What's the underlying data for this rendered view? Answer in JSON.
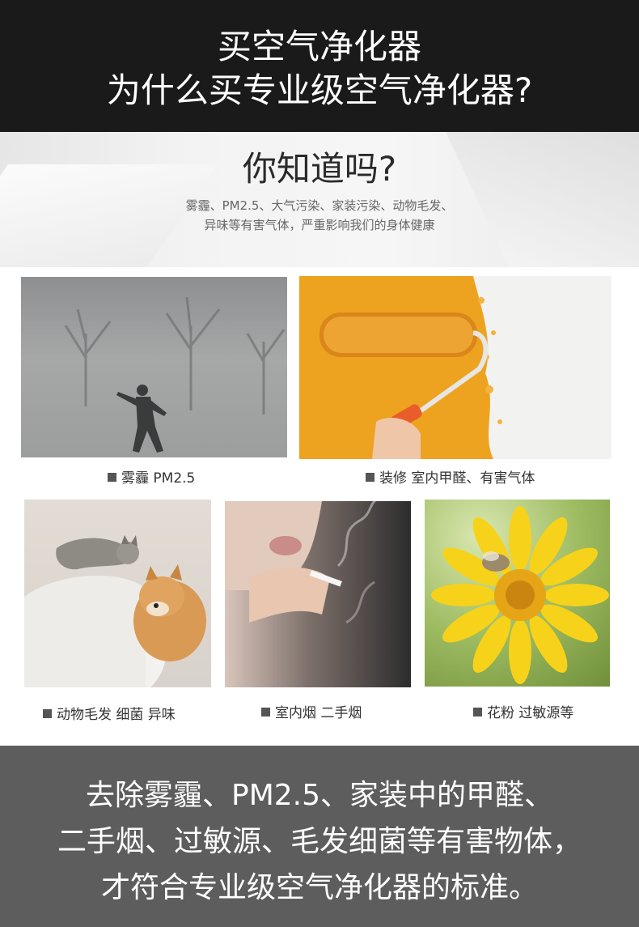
{
  "header": {
    "line1": "买空气净化器",
    "line2": "为什么买专业级空气净化器?"
  },
  "intro": {
    "question": "你知道吗?",
    "desc_line1": "雾霾、PM2.5、大气污染、家装污染、动物毛发、",
    "desc_line2": "异味等有害气体，严重影响我们的身体健康"
  },
  "cards": [
    {
      "caption": "雾霾 PM2.5",
      "image": "smog-photo"
    },
    {
      "caption": "装修  室内甲醛、有害气体",
      "image": "paint-roller-photo"
    },
    {
      "caption": "动物毛发 细菌 异味",
      "image": "cat-and-dog-photo"
    },
    {
      "caption": "室内烟 二手烟",
      "image": "smoking-photo"
    },
    {
      "caption": "花粉 过敏源等",
      "image": "flower-with-bee-photo"
    }
  ],
  "footer": {
    "line1": "去除雾霾、PM2.5、家装中的甲醛、",
    "line2": "二手烟、过敏源、毛发细菌等有害物体，",
    "line3": "才符合专业级空气净化器的标准。"
  },
  "colors": {
    "header_bg": "#1b1a1b",
    "footer_bg": "#5d5d5d",
    "paint_yellow": "#eda31f",
    "flower_yellow": "#f7d21a"
  }
}
